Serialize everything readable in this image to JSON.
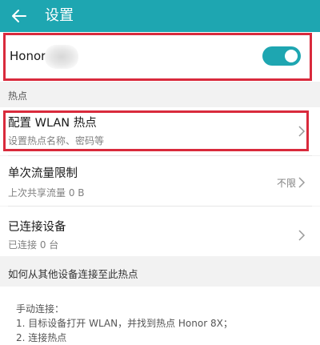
{
  "topbar": {
    "title": "设置",
    "bg_color": "#1ea6b1",
    "back_icon": "arrow-left-icon"
  },
  "hotspot": {
    "name": "Honor",
    "enabled": true,
    "toggle_color": "#1ea6b1"
  },
  "section_hotspot": {
    "title": "热点"
  },
  "config_wlan": {
    "title": "配置 WLAN 热点",
    "subtitle": "设置热点名称、密码等",
    "icon": "chevron-right-icon"
  },
  "data_limit": {
    "title": "单次流量限制",
    "subtitle": "上次共享流量 0 B",
    "value": "不限",
    "icon": "chevron-right-icon"
  },
  "connected_devices": {
    "title": "已连接设备",
    "subtitle": "已连接 0 台",
    "icon": "chevron-right-icon"
  },
  "section_help": {
    "title": "如何从其他设备连接至此热点"
  },
  "help": {
    "line1": "手动连接：",
    "line2": "1. 目标设备打开 WLAN，并找到热点 Honor 8X；",
    "line3": "2. 连接热点"
  },
  "annotation_color": "#d92a3c"
}
